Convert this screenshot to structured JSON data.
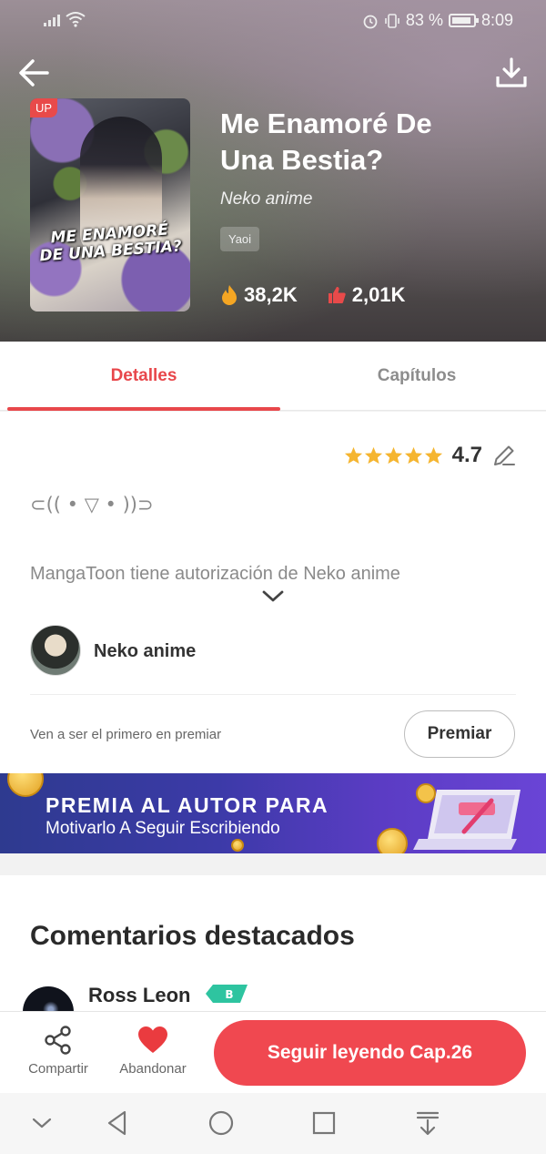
{
  "status_bar": {
    "battery_percent": "83 %",
    "time": "8:09"
  },
  "header": {
    "up_badge": "UP",
    "cover_title": "ME ENAMORÉ DE UNA BESTIA?",
    "title_line1": "Me Enamoré De",
    "title_line2": "Una Bestia?",
    "author": "Neko anime",
    "tag": "Yaoi",
    "views": "38,2K",
    "likes": "2,01K"
  },
  "tabs": [
    {
      "label": "Detalles",
      "active": true
    },
    {
      "label": "Capítulos",
      "active": false
    }
  ],
  "details": {
    "rating_value": "4.7",
    "stars": 5,
    "kaomoji": "⊂(( • ▽ • ))⊃",
    "license_text": "MangaToon tiene autorización de Neko anime",
    "author_name": "Neko anime",
    "premiar_text": "Ven a ser el primero en premiar",
    "premiar_button": "Premiar"
  },
  "banner": {
    "line1": "PREMIA AL AUTOR PARA",
    "line2": "Motivarlo A Seguir Escribiendo"
  },
  "comments": {
    "title": "Comentarios destacados",
    "first_user": "Ross Leon",
    "first_user_badge": "B"
  },
  "bottom_bar": {
    "share_label": "Compartir",
    "abandon_label": "Abandonar",
    "continue_label": "Seguir leyendo Cap.26"
  },
  "colors": {
    "accent": "#e8474b",
    "cta": "#f04850",
    "star": "#f5b530",
    "flame": "#f5a623",
    "like": "#e84a4a"
  }
}
